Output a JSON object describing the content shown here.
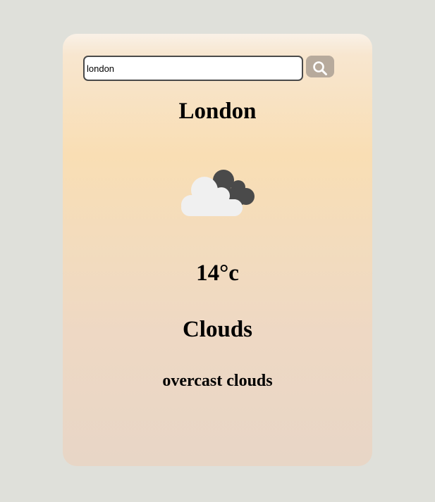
{
  "search": {
    "value": "london",
    "button_icon": "search-icon"
  },
  "weather": {
    "city": "London",
    "icon": "overcast-clouds-icon",
    "temperature": "14°c",
    "condition": "Clouds",
    "description": "overcast clouds"
  },
  "colors": {
    "page_background": "#dfe0da",
    "search_button": "#b7aa9c",
    "dark_cloud": "#4a4a4a",
    "light_cloud": "#f0f0f0"
  }
}
